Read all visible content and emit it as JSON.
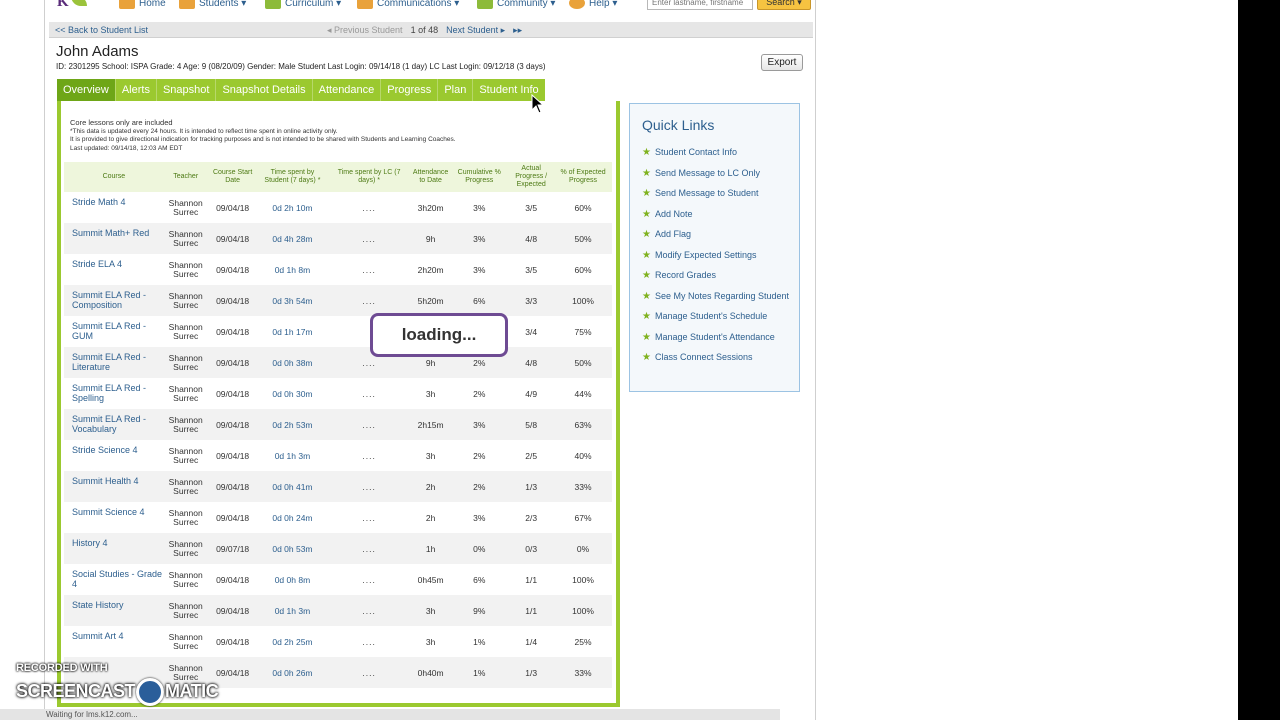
{
  "nav": {
    "logo": "K",
    "items": [
      {
        "label": "Home",
        "icon": "home-icon"
      },
      {
        "label": "Students ▾",
        "icon": "students-icon"
      },
      {
        "label": "Curriculum ▾",
        "icon": "curriculum-icon"
      },
      {
        "label": "Communications ▾",
        "icon": "communications-icon"
      },
      {
        "label": "Community ▾",
        "icon": "community-icon"
      },
      {
        "label": "Help ▾",
        "icon": "help-icon"
      }
    ],
    "search_placeholder": "Enter lastname, firstname",
    "search_label": "Search ▾"
  },
  "student_bar": {
    "back": "<<  Back to Student List",
    "prev": "◂  Previous Student",
    "position": "1 of 48",
    "next": "Next Student  ▸",
    "last": "▸▸"
  },
  "student": {
    "name": "John Adams",
    "info": "ID: 2301295    School: ISPA    Grade: 4    Age: 9 (08/20/09)    Gender: Male    Student Last Login: 09/14/18 (1 day)    LC Last Login: 09/12/18 (3 days)",
    "export_label": "Export"
  },
  "tabs": [
    "Overview",
    "Alerts",
    "Snapshot",
    "Snapshot Details",
    "Attendance",
    "Progress",
    "Plan",
    "Student Info"
  ],
  "notes": {
    "line1": "Core lessons only are included",
    "line2": "*This data is updated every 24 hours. It is intended to reflect time spent in online activity only.",
    "line3": "It is provided to give directional indication for tracking purposes and is not intended to be shared with Students and Learning Coaches.",
    "line4": "Last updated: 09/14/18, 12:03 AM EDT"
  },
  "table": {
    "headers": [
      "Course",
      "Teacher",
      "Course Start Date",
      "Time spent by Student (7 days) *",
      "Time spent by LC (7 days) *",
      "Attendance to Date",
      "Cumulative % Progress",
      "Actual Progress / Expected",
      "% of Expected Progress"
    ],
    "rows": [
      {
        "course": "Stride Math 4",
        "teacher": "Shannon Surrec",
        "start": "09/04/18",
        "student_time": "0d 2h 10m",
        "lc_time": "....",
        "attendance": "3h20m",
        "cum": "3%",
        "actual": "3/5",
        "pct": "60%"
      },
      {
        "course": "Summit Math+ Red",
        "teacher": "Shannon Surrec",
        "start": "09/04/18",
        "student_time": "0d 4h 28m",
        "lc_time": "....",
        "attendance": "9h",
        "cum": "3%",
        "actual": "4/8",
        "pct": "50%"
      },
      {
        "course": "Stride ELA 4",
        "teacher": "Shannon Surrec",
        "start": "09/04/18",
        "student_time": "0d 1h 8m",
        "lc_time": "....",
        "attendance": "2h20m",
        "cum": "3%",
        "actual": "3/5",
        "pct": "60%"
      },
      {
        "course": "Summit ELA Red - Composition",
        "teacher": "Shannon Surrec",
        "start": "09/04/18",
        "student_time": "0d 3h 54m",
        "lc_time": "....",
        "attendance": "5h20m",
        "cum": "6%",
        "actual": "3/3",
        "pct": "100%"
      },
      {
        "course": "Summit ELA Red - GUM",
        "teacher": "Shannon Surrec",
        "start": "09/04/18",
        "student_time": "0d 1h 17m",
        "lc_time": "",
        "attendance": "",
        "cum": "",
        "actual": "3/4",
        "pct": "75%"
      },
      {
        "course": "Summit ELA Red - Literature",
        "teacher": "Shannon Surrec",
        "start": "09/04/18",
        "student_time": "0d 0h 38m",
        "lc_time": "....",
        "attendance": "9h",
        "cum": "2%",
        "actual": "4/8",
        "pct": "50%"
      },
      {
        "course": "Summit ELA Red - Spelling",
        "teacher": "Shannon Surrec",
        "start": "09/04/18",
        "student_time": "0d 0h 30m",
        "lc_time": "....",
        "attendance": "3h",
        "cum": "2%",
        "actual": "4/9",
        "pct": "44%"
      },
      {
        "course": "Summit ELA Red - Vocabulary",
        "teacher": "Shannon Surrec",
        "start": "09/04/18",
        "student_time": "0d 2h 53m",
        "lc_time": "....",
        "attendance": "2h15m",
        "cum": "3%",
        "actual": "5/8",
        "pct": "63%"
      },
      {
        "course": "Stride Science 4",
        "teacher": "Shannon Surrec",
        "start": "09/04/18",
        "student_time": "0d 1h 3m",
        "lc_time": "....",
        "attendance": "3h",
        "cum": "2%",
        "actual": "2/5",
        "pct": "40%"
      },
      {
        "course": "Summit Health 4",
        "teacher": "Shannon Surrec",
        "start": "09/04/18",
        "student_time": "0d 0h 41m",
        "lc_time": "....",
        "attendance": "2h",
        "cum": "2%",
        "actual": "1/3",
        "pct": "33%"
      },
      {
        "course": "Summit Science 4",
        "teacher": "Shannon Surrec",
        "start": "09/04/18",
        "student_time": "0d 0h 24m",
        "lc_time": "....",
        "attendance": "2h",
        "cum": "3%",
        "actual": "2/3",
        "pct": "67%"
      },
      {
        "course": "History 4",
        "teacher": "Shannon Surrec",
        "start": "09/07/18",
        "student_time": "0d 0h 53m",
        "lc_time": "....",
        "attendance": "1h",
        "cum": "0%",
        "actual": "0/3",
        "pct": "0%"
      },
      {
        "course": "Social Studies - Grade 4",
        "teacher": "Shannon Surrec",
        "start": "09/04/18",
        "student_time": "0d 0h 8m",
        "lc_time": "....",
        "attendance": "0h45m",
        "cum": "6%",
        "actual": "1/1",
        "pct": "100%"
      },
      {
        "course": "State History",
        "teacher": "Shannon Surrec",
        "start": "09/04/18",
        "student_time": "0d 1h 3m",
        "lc_time": "....",
        "attendance": "3h",
        "cum": "9%",
        "actual": "1/1",
        "pct": "100%"
      },
      {
        "course": "Summit Art 4",
        "teacher": "Shannon Surrec",
        "start": "09/04/18",
        "student_time": "0d 2h 25m",
        "lc_time": "....",
        "attendance": "3h",
        "cum": "1%",
        "actual": "1/4",
        "pct": "25%"
      },
      {
        "course": "",
        "teacher": "Shannon Surrec",
        "start": "09/04/18",
        "student_time": "0d 0h 26m",
        "lc_time": "....",
        "attendance": "0h40m",
        "cum": "1%",
        "actual": "1/3",
        "pct": "33%"
      }
    ]
  },
  "loading_text": "loading...",
  "quick_links": {
    "title": "Quick Links",
    "items": [
      "Student Contact Info",
      "Send Message to LC Only",
      "Send Message to Student",
      "Add Note",
      "Add Flag",
      "Modify Expected Settings",
      "Record Grades",
      "See My Notes Regarding Student",
      "Manage Student's Schedule",
      "Manage Student's Attendance",
      "Class Connect Sessions"
    ]
  },
  "status_text": "Waiting for lms.k12.com...",
  "watermark": {
    "line1": "RECORDED WITH",
    "line2a": "SCREENCAST",
    "line2b": "MATIC"
  },
  "colors": {
    "tab_green": "#9bc92f",
    "tab_active": "#6ea617",
    "link_blue": "#2d5f8e",
    "loading_border": "#6e4b93"
  }
}
